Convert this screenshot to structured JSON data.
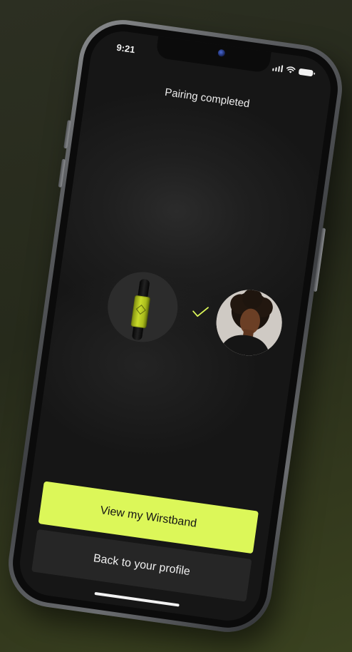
{
  "status_bar": {
    "time": "9:21"
  },
  "screen": {
    "title": "Pairing completed"
  },
  "pairing": {
    "device_icon": "wristband-icon",
    "check_icon": "checkmark-icon",
    "avatar_icon": "user-avatar"
  },
  "actions": {
    "primary_label": "View my Wirstband",
    "secondary_label": "Back to your profile"
  },
  "colors": {
    "accent": "#dcf759",
    "screen_bg": "#1a1a1a",
    "secondary_button_bg": "#262626",
    "backdrop": "#2a2f1f"
  }
}
